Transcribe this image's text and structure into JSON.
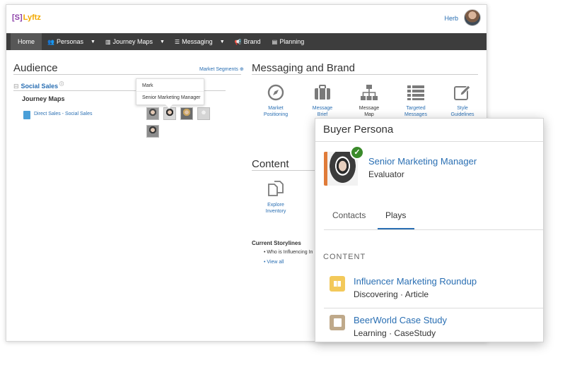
{
  "app": {
    "logo_bracket": "[S]",
    "logo_text": "Lyftz",
    "user_name": "Herb"
  },
  "nav": {
    "home": "Home",
    "personas": "Personas",
    "journey_maps": "Journey Maps",
    "messaging": "Messaging",
    "brand": "Brand",
    "planning": "Planning"
  },
  "audience": {
    "title": "Audience",
    "market_segments": "Market Segments",
    "segment": "Social Sales",
    "journey_maps_label": "Journey Maps",
    "journey_link": "Direct Sales - Social Sales",
    "tooltip_name": "Mark",
    "tooltip_role": "Senior Marketing Manager"
  },
  "messaging_brand": {
    "title": "Messaging and Brand",
    "items": [
      {
        "line1": "Market",
        "line2": "Positioning",
        "icon": "compass-icon"
      },
      {
        "line1": "Message",
        "line2": "Brief",
        "icon": "briefcase-icon"
      },
      {
        "line1": "Message",
        "line2": "Map",
        "icon": "sitemap-icon"
      },
      {
        "line1": "Targeted",
        "line2": "Messages",
        "icon": "list-icon"
      },
      {
        "line1": "Style",
        "line2": "Guidelines",
        "icon": "edit-icon"
      }
    ]
  },
  "content_section": {
    "title": "Content",
    "explore_line1": "Explore",
    "explore_line2": "Inventory",
    "storylines_title": "Current Storylines",
    "storyline_item": "Who is Influencing In",
    "view_all": "View all"
  },
  "panel": {
    "title": "Buyer Persona",
    "role": "Senior Marketing Manager",
    "status": "Evaluator",
    "tabs": [
      "Contacts",
      "Plays"
    ],
    "active_tab": "Plays",
    "content_label": "CONTENT",
    "items": [
      {
        "title": "Influencer Marketing Roundup",
        "stage": "Discovering",
        "type": "Article",
        "icon": "book-icon"
      },
      {
        "title": "BeerWorld Case Study",
        "stage": "Learning",
        "type": "CaseStudy",
        "icon": "document-icon"
      }
    ]
  },
  "colors": {
    "nav_bg": "#3d3d3d",
    "link": "#2a6fb3",
    "check": "#3a8a2a",
    "logo_bracket": "#8b3fa8",
    "logo_text": "#f2a800"
  }
}
